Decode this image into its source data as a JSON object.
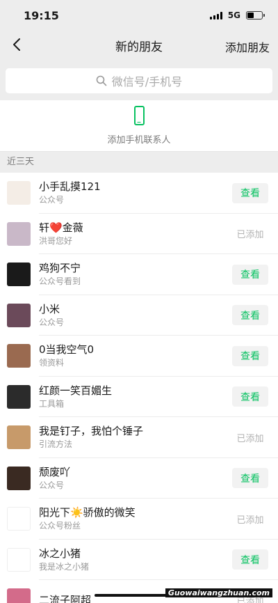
{
  "status": {
    "time": "19:15",
    "network": "5G"
  },
  "nav": {
    "title": "新的朋友",
    "action": "添加朋友"
  },
  "search": {
    "placeholder": "微信号/手机号"
  },
  "add_contacts": {
    "label": "添加手机联系人"
  },
  "section": {
    "title": "近三天"
  },
  "contacts": [
    {
      "name": "小手乱摸121",
      "sub": "公众号",
      "status": "查看",
      "added": false,
      "avatar_color": "#f4ede6"
    },
    {
      "name": "轩❤️金薇",
      "sub": "洪哥您好",
      "status": "已添加",
      "added": true,
      "avatar_color": "#c9b8c8"
    },
    {
      "name": "鸡狗不宁",
      "sub": "公众号看到",
      "status": "查看",
      "added": false,
      "avatar_color": "#1a1a1a"
    },
    {
      "name": "小米",
      "sub": "公众号",
      "status": "查看",
      "added": false,
      "avatar_color": "#6b4a5a"
    },
    {
      "name": "0当我空气0",
      "sub": "领资料",
      "status": "查看",
      "added": false,
      "avatar_color": "#9a6a50"
    },
    {
      "name": "红颜一笑百媚生",
      "sub": "工具箱",
      "status": "查看",
      "added": false,
      "avatar_color": "#2b2b2b"
    },
    {
      "name": "我是钉子，我怕个锤子",
      "sub": "引流方法",
      "status": "已添加",
      "added": true,
      "avatar_color": "#c79a6a"
    },
    {
      "name": "颓废吖",
      "sub": "公众号",
      "status": "查看",
      "added": false,
      "avatar_color": "#3a2a22"
    },
    {
      "name": "阳光下☀️骄傲的微笑",
      "sub": "公众号粉丝",
      "status": "已添加",
      "added": true,
      "avatar_color": "#ffffff"
    },
    {
      "name": "冰之小猪",
      "sub": "我是冰之小猪",
      "status": "查看",
      "added": false,
      "avatar_color": "#ffffff"
    },
    {
      "name": "二流子阿超",
      "sub": "",
      "status": "已添加",
      "added": true,
      "avatar_color": "#d36b8a"
    }
  ],
  "watermark": "Guowaiwangzhuan.com",
  "colors": {
    "accent": "#07c160",
    "background": "#ededed"
  }
}
